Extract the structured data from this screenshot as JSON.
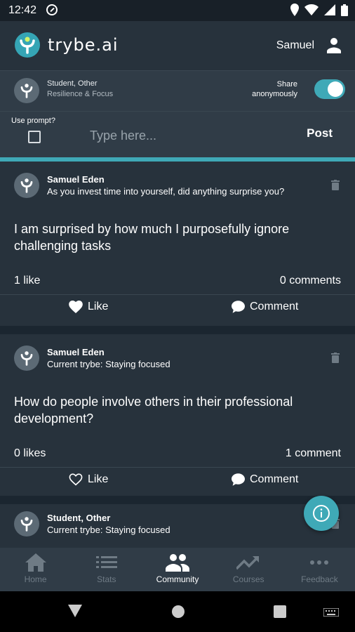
{
  "status_bar": {
    "time": "12:42"
  },
  "app_bar": {
    "brand": "trybe.ai",
    "username": "Samuel"
  },
  "info_bar": {
    "role": "Student, Other",
    "tribe": "Resilience & Focus",
    "share_label_line1": "Share",
    "share_label_line2": "anonymously",
    "share_anonymously": true
  },
  "composer": {
    "prompt_label": "Use prompt?",
    "placeholder": "Type here...",
    "post_label": "Post"
  },
  "posts": [
    {
      "author": "Samuel Eden",
      "subtitle": "As you invest time into yourself, did anything surprise you?",
      "body": "I am surprised by how much I purposefully ignore challenging tasks",
      "likes": "1 like",
      "comments": "0 comments",
      "like_label": "Like",
      "comment_label": "Comment",
      "liked": true
    },
    {
      "author": "Samuel Eden",
      "subtitle": "Current trybe: Staying focused",
      "body": "How do people involve others in their professional development?",
      "likes": "0 likes",
      "comments": "1 comment",
      "like_label": "Like",
      "comment_label": "Comment",
      "liked": false
    },
    {
      "author": "Student, Other",
      "subtitle": "Current trybe: Staying focused"
    }
  ],
  "bottom_nav": [
    {
      "label": "Home",
      "icon": "home-icon",
      "active": false
    },
    {
      "label": "Stats",
      "icon": "list-icon",
      "active": false
    },
    {
      "label": "Community",
      "icon": "people-icon",
      "active": true
    },
    {
      "label": "Courses",
      "icon": "trending-icon",
      "active": false
    },
    {
      "label": "Feedback",
      "icon": "more-icon",
      "active": false
    }
  ],
  "colors": {
    "accent": "#3fa9b7",
    "background": "#1b2630",
    "card": "#27323c"
  }
}
